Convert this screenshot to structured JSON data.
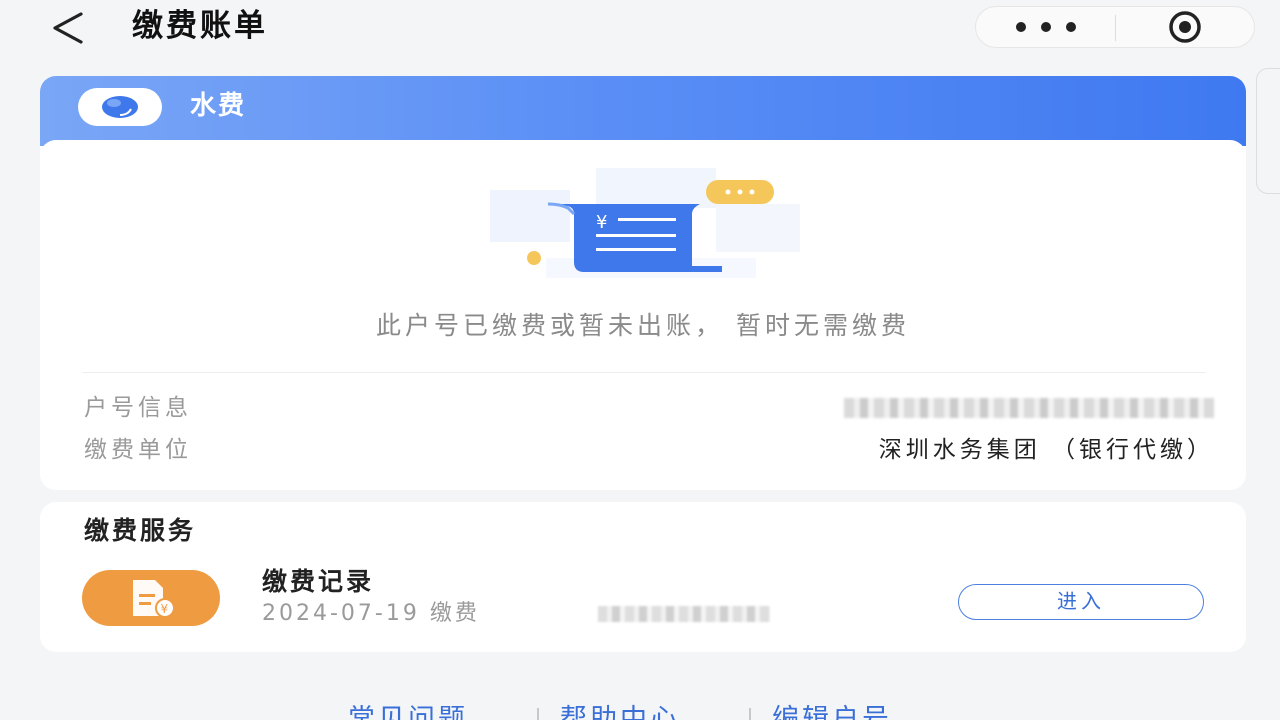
{
  "header": {
    "back_icon": "chevron-left-icon",
    "title": "缴费账单",
    "more_icon": "more-dots-icon",
    "close_icon": "target-circle-icon"
  },
  "water_card": {
    "title": "水费",
    "logo_icon": "water-drop-icon",
    "illustration_icon": "bill-receipt-icon",
    "illustration_symbol": "¥",
    "empty_message": "此户号已缴费或暂未出账， 暂时无需缴费",
    "account_label": "户号信息",
    "account_value_obscured": true,
    "unit_label": "缴费单位",
    "unit_value": "深圳水务集团 （银行代缴）"
  },
  "service": {
    "title": "缴费服务",
    "record_icon": "payment-record-icon",
    "record_title": "缴费记录",
    "record_subtitle": "2024-07-19 缴费",
    "enter_label": "进入"
  },
  "footer": {
    "links": [
      "常见问题",
      "帮助中心",
      "编辑户号"
    ]
  },
  "colors": {
    "header_gradient_start": "#7aa6f6",
    "header_gradient_end": "#3f79f1",
    "link_blue": "#3a6fd8",
    "record_icon_orange": "#ef9b42",
    "background": "#f4f5f7"
  }
}
